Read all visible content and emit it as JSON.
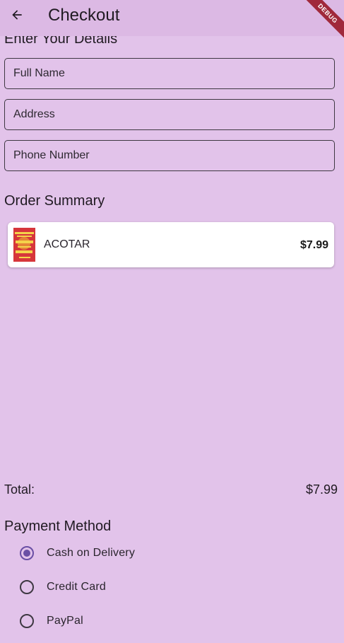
{
  "appbar": {
    "title": "Checkout",
    "debug_label": "DEBUG",
    "back_icon": "arrow-back-icon"
  },
  "details": {
    "title": "Enter Your Details",
    "full_name_placeholder": "Full Name",
    "address_placeholder": "Address",
    "phone_placeholder": "Phone Number"
  },
  "order_summary": {
    "title": "Order Summary",
    "items": [
      {
        "title": "ACOTAR",
        "price": "$7.99",
        "cover_text": "A COURT OF THORNS AND ROSES"
      }
    ]
  },
  "total": {
    "label": "Total:",
    "value": "$7.99"
  },
  "payment": {
    "title": "Payment Method",
    "options": [
      {
        "label": "Cash on Delivery",
        "selected": true
      },
      {
        "label": "Credit Card",
        "selected": false
      },
      {
        "label": "PayPal",
        "selected": false
      }
    ]
  },
  "colors": {
    "background": "#e2c3ea",
    "appbar": "#dcb9e4",
    "accent": "#6a4fa5",
    "debug_banner": "#a0293b"
  }
}
